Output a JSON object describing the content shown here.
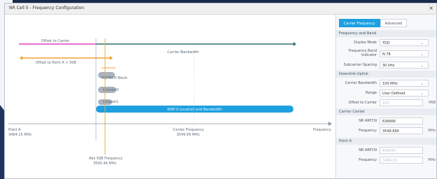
{
  "window": {
    "title": "NR Cell 0 - Frequency Configuration",
    "close": "×"
  },
  "chart": {
    "offset_to_carrier": "Offset to Carrier",
    "offset_to_point_a": "Offset to Point A + SSB",
    "carrier_bandwidth": "Carrier Bandwidth",
    "ss_pbch_block": "SS/PBCH Block",
    "coreset0": "Coreset0",
    "coreset1": "Coreset1",
    "bwp_label": "BWP 0 Location and Bandwidth",
    "point_a": "Point A",
    "point_a_freq": "3464.15 MHz",
    "center_freq_label": "Center Frequency",
    "center_freq_val": "3549.69 MHz",
    "frequency_axis": "Frequency",
    "abs_ssb_label": "Abs SSB Frequency",
    "abs_ssb_val": "3505.44 MHz"
  },
  "panel": {
    "tabs": [
      "Carrier Frequency",
      "Advanced"
    ],
    "freq_band_section": "Frequency and Band",
    "duplex_mode_label": "Duplex Mode",
    "duplex_mode_value": "TDD",
    "freq_band_label": "Frequency Band Indicator",
    "freq_band_value": "N 78",
    "subcarrier_label": "Subcarrier Spacing",
    "subcarrier_value": "30 kHz",
    "downlink_section": "Downlink-Uplink",
    "carrier_bw_label": "Carrier Bandwidth",
    "carrier_bw_value": "100 MHz",
    "range_label": "Range",
    "range_value": "User Defined",
    "offset_label": "Offset to Carrier",
    "offset_value": "103",
    "offset_unit": "PRB",
    "carrier_center_section": "Carrier Center",
    "nrarfcn_label": "NR ARFCN",
    "nrarfcn_value": "636666",
    "frequency_label": "Frequency",
    "frequency_value": "3549.690",
    "frequency_unit": "MHz",
    "point_a_section": "Point A",
    "pa_nrarfcn_label": "NR ARFCN",
    "pa_nrarfcn_value": "630943",
    "pa_frequency_label": "Frequency",
    "pa_frequency_value": "3464.15",
    "pa_frequency_unit": "MHz"
  },
  "colors": {
    "offset_carrier": "#e040c0",
    "offset_point_a": "#f0a030",
    "carrier_bw": "#2f6f6f",
    "bwp": "#1ea0e0",
    "coreset": "#aab3be",
    "abs_ssb_line": "#e0b040"
  }
}
